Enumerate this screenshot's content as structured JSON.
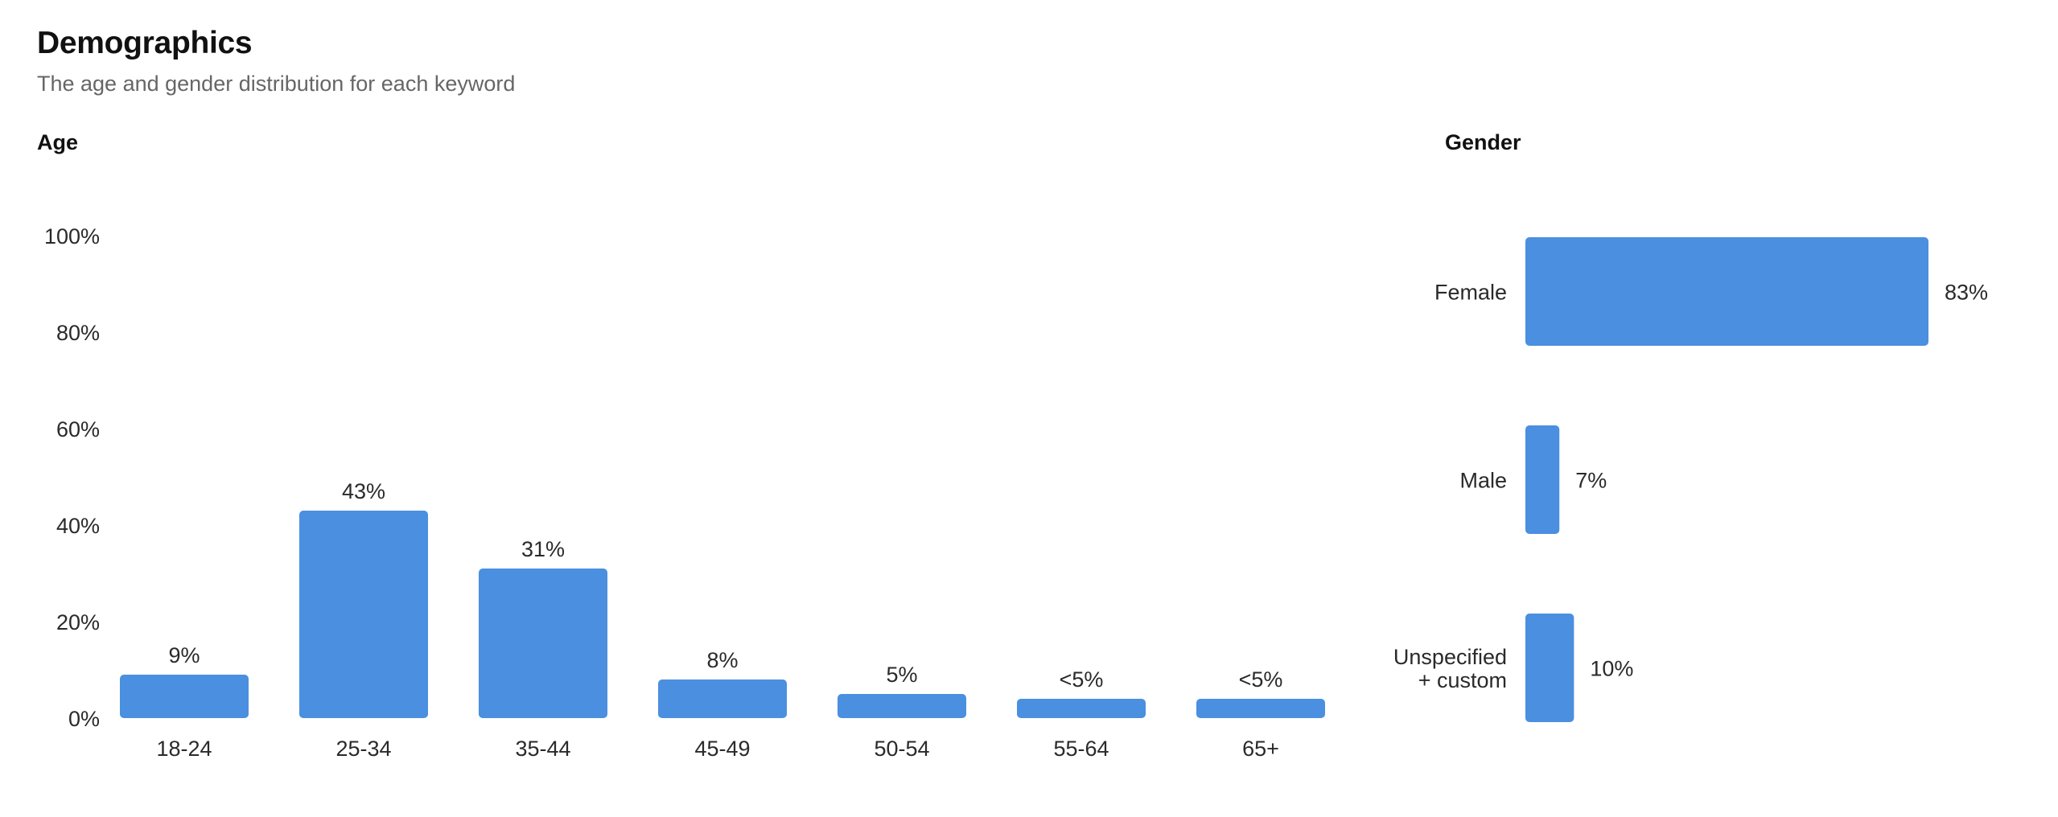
{
  "header": {
    "title": "Demographics",
    "subtitle": "The age and gender distribution for each keyword"
  },
  "colors": {
    "bar": "#4a8fe0",
    "text": "#2a2a2a",
    "subtitle": "#666666"
  },
  "chart_data": [
    {
      "type": "bar",
      "orientation": "vertical",
      "title": "Age",
      "xlabel": "",
      "ylabel": "",
      "ylim": [
        0,
        100
      ],
      "y_ticks": [
        "0%",
        "20%",
        "40%",
        "60%",
        "80%",
        "100%"
      ],
      "y_tick_values": [
        0,
        20,
        40,
        60,
        80,
        100
      ],
      "grid": false,
      "categories": [
        "18-24",
        "25-34",
        "35-44",
        "45-49",
        "50-54",
        "55-64",
        "65+"
      ],
      "values": [
        9,
        43,
        31,
        8,
        5,
        4,
        4
      ],
      "data_labels": [
        "9%",
        "43%",
        "31%",
        "8%",
        "5%",
        "<5%",
        "<5%"
      ]
    },
    {
      "type": "bar",
      "orientation": "horizontal",
      "title": "Gender",
      "xlim": [
        0,
        100
      ],
      "grid": false,
      "categories": [
        [
          "Female"
        ],
        [
          "Male"
        ],
        [
          "Unspecified",
          "+ custom"
        ]
      ],
      "values": [
        83,
        7,
        10
      ],
      "data_labels": [
        "83%",
        "7%",
        "10%"
      ]
    }
  ]
}
